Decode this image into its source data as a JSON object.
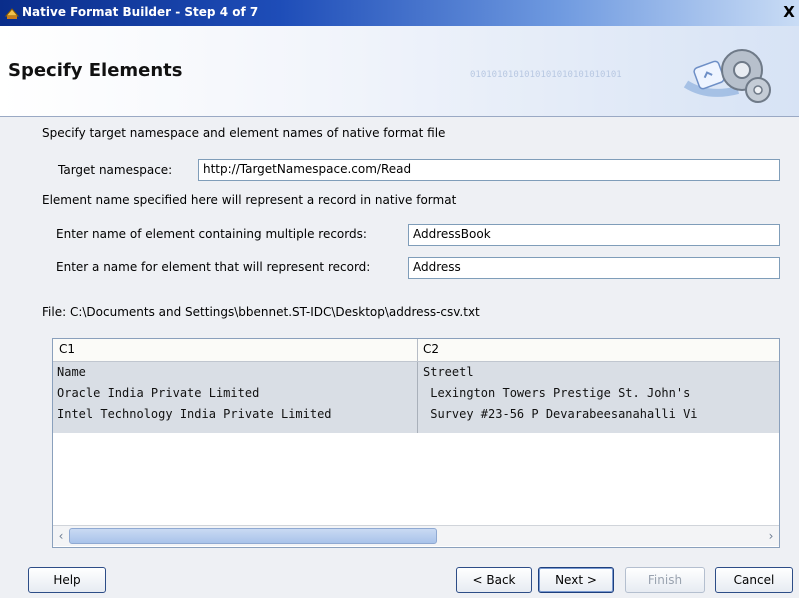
{
  "window": {
    "title": "Native Format Builder - Step 4 of 7",
    "close_glyph": "X"
  },
  "header": {
    "title": "Specify Elements",
    "binary_text": "0101010101010101010101010101"
  },
  "form": {
    "intro": "Specify target namespace and element names of native format file",
    "namespace_label": "Target namespace:",
    "namespace_value": "http://TargetNamespace.com/Read",
    "element_note": "Element name specified here will represent a record in native format",
    "multi_label": "Enter name of element containing multiple records:",
    "multi_value": "AddressBook",
    "record_label": "Enter a name for element that will represent record:",
    "record_value": "Address",
    "file_label": "File: C:\\Documents and Settings\\bbennet.ST-IDC\\Desktop\\address-csv.txt"
  },
  "table": {
    "columns": [
      "C1",
      "C2"
    ],
    "rows": [
      [
        "Name",
        "Streetl"
      ],
      [
        "Oracle India Private Limited",
        " Lexington Towers Prestige St. John's"
      ],
      [
        "Intel Technology India Private Limited",
        " Survey #23-56 P Devarabeesanahalli Vi"
      ]
    ]
  },
  "buttons": {
    "help": "Help",
    "back": "< Back",
    "next": "Next >",
    "finish": "Finish",
    "cancel": "Cancel"
  }
}
